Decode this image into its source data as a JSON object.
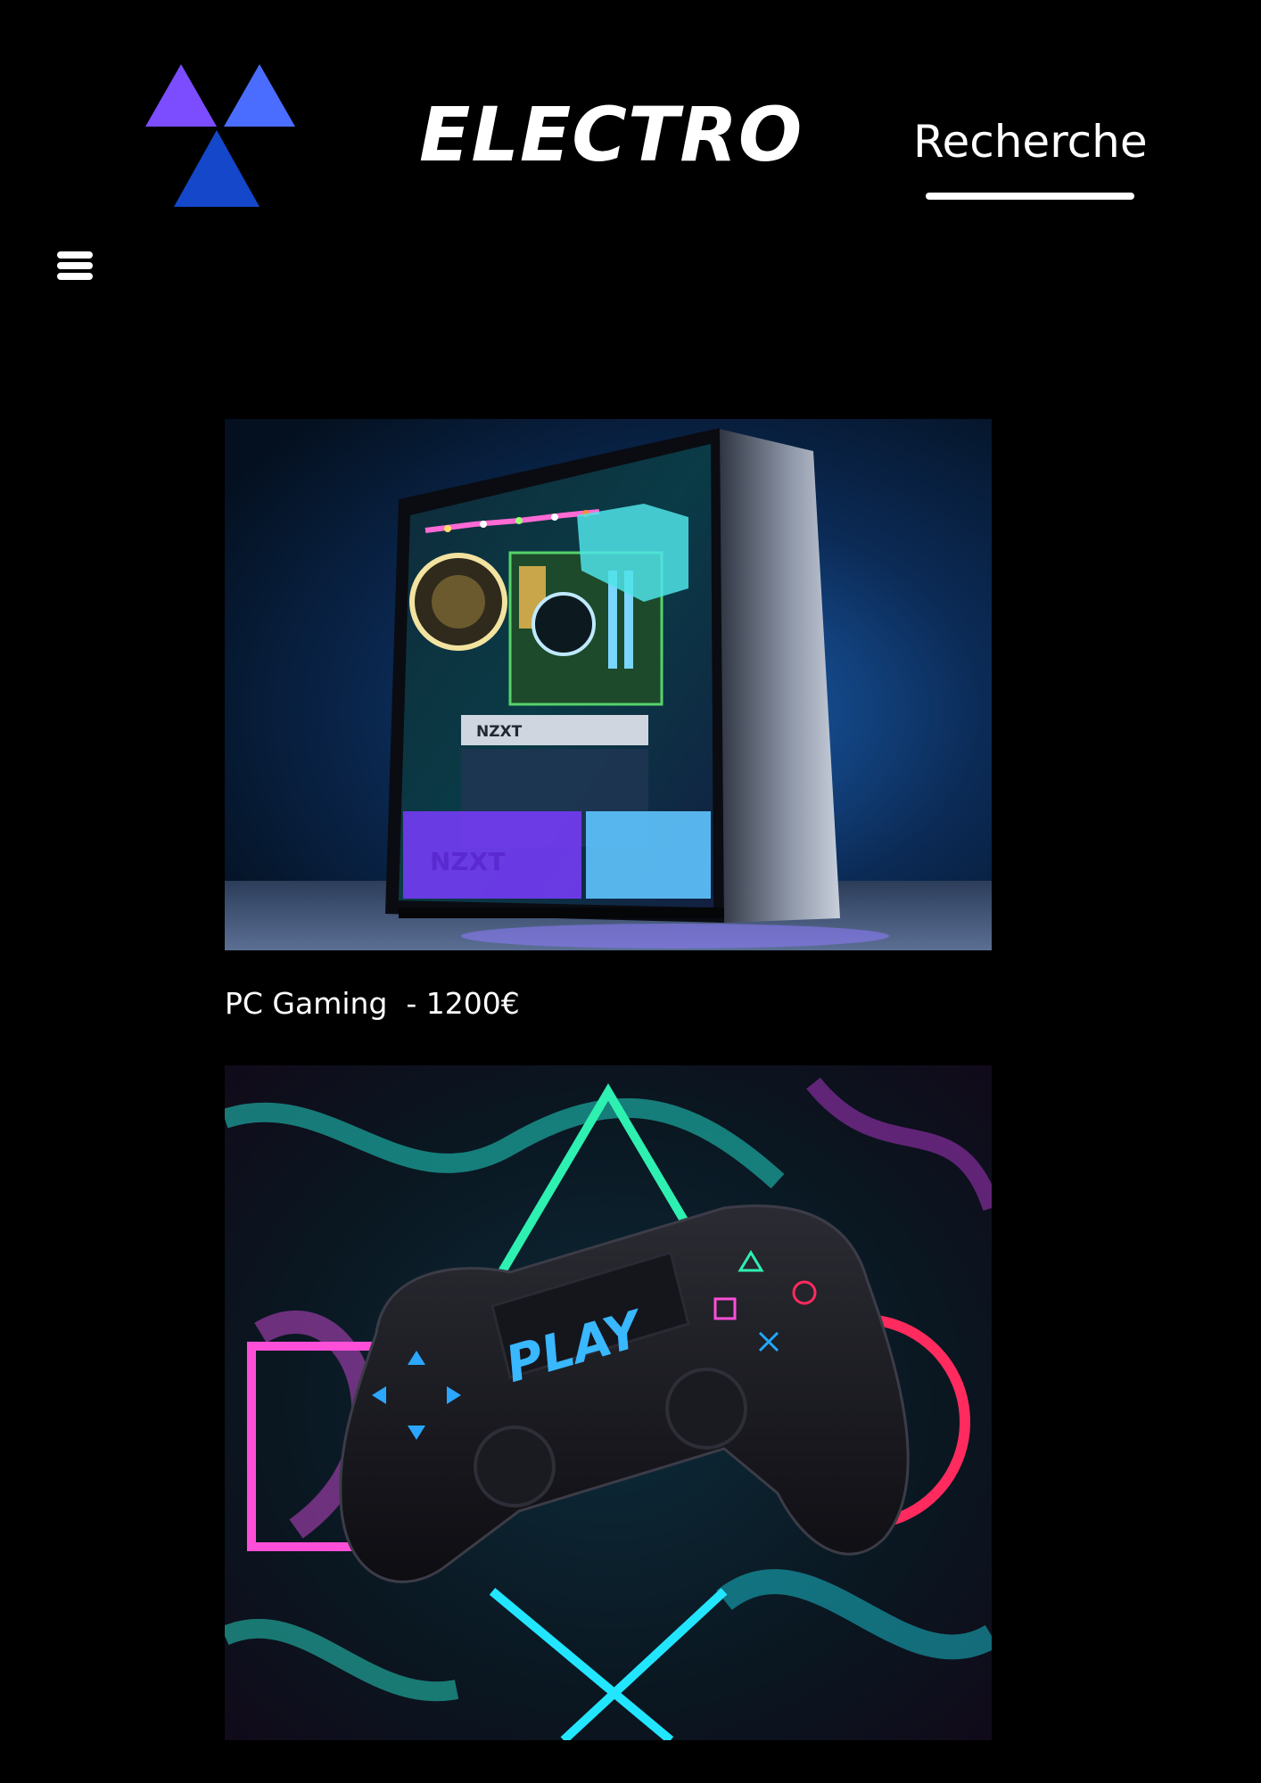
{
  "header": {
    "brand": "ELECTRO",
    "search_label": "Recherche",
    "logo_icon": "three-triangles-logo",
    "menu_icon": "hamburger-menu-icon"
  },
  "products": [
    {
      "caption": "PC Gaming  - 1200€",
      "image": "gaming-pc-case-photo",
      "image_text": [
        "NZXT",
        "NZXT"
      ]
    },
    {
      "caption": "",
      "image": "game-controller-photo",
      "image_text": [
        "PLAY"
      ]
    }
  ],
  "colors": {
    "background": "#000000",
    "text": "#ffffff",
    "logo_triangle_1": "#7b4dff",
    "logo_triangle_2": "#4a6dff",
    "logo_triangle_3": "#1447c9"
  }
}
